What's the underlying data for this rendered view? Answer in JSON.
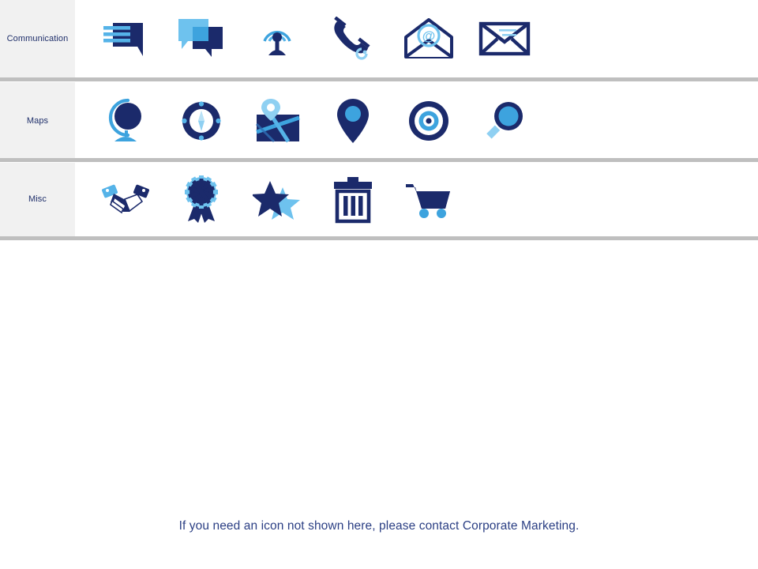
{
  "colors": {
    "navy": "#1b2a6b",
    "navy_dark": "#16265f",
    "light_blue": "#55b3e8",
    "pale_blue": "#8fd0f2",
    "mid_blue": "#2f9bdc",
    "row_label_bg": "#f1f1f1",
    "divider": "#bfbfbf",
    "text_blue": "#20306b",
    "footer_text": "#2b3f84",
    "page_bg": "#ffffff"
  },
  "rows": [
    {
      "id": "communication",
      "label": "Communication",
      "icons": [
        {
          "name": "message-lines-icon",
          "title": "message with lines"
        },
        {
          "name": "chat-bubbles-icon",
          "title": "chat bubbles"
        },
        {
          "name": "broadcast-tower-icon",
          "title": "broadcast tower"
        },
        {
          "name": "telephone-icon",
          "title": "telephone handset"
        },
        {
          "name": "email-at-icon",
          "title": "open envelope with at sign"
        },
        {
          "name": "envelope-icon",
          "title": "envelope"
        }
      ]
    },
    {
      "id": "maps",
      "label": "Maps",
      "icons": [
        {
          "name": "globe-icon",
          "title": "desk globe"
        },
        {
          "name": "compass-icon",
          "title": "compass"
        },
        {
          "name": "map-pin-sheet-icon",
          "title": "map with pin"
        },
        {
          "name": "location-pin-icon",
          "title": "location pin"
        },
        {
          "name": "target-icon",
          "title": "target"
        },
        {
          "name": "magnifier-icon",
          "title": "magnifying glass"
        }
      ]
    },
    {
      "id": "misc",
      "label": "Misc",
      "icons": [
        {
          "name": "handshake-icon",
          "title": "handshake"
        },
        {
          "name": "award-ribbon-icon",
          "title": "award ribbon"
        },
        {
          "name": "stars-icon",
          "title": "two stars"
        },
        {
          "name": "trash-can-icon",
          "title": "trash can"
        },
        {
          "name": "shopping-cart-icon",
          "title": "shopping cart"
        }
      ]
    }
  ],
  "footer": {
    "note": "If you need an icon not shown here, please contact Corporate Marketing."
  }
}
